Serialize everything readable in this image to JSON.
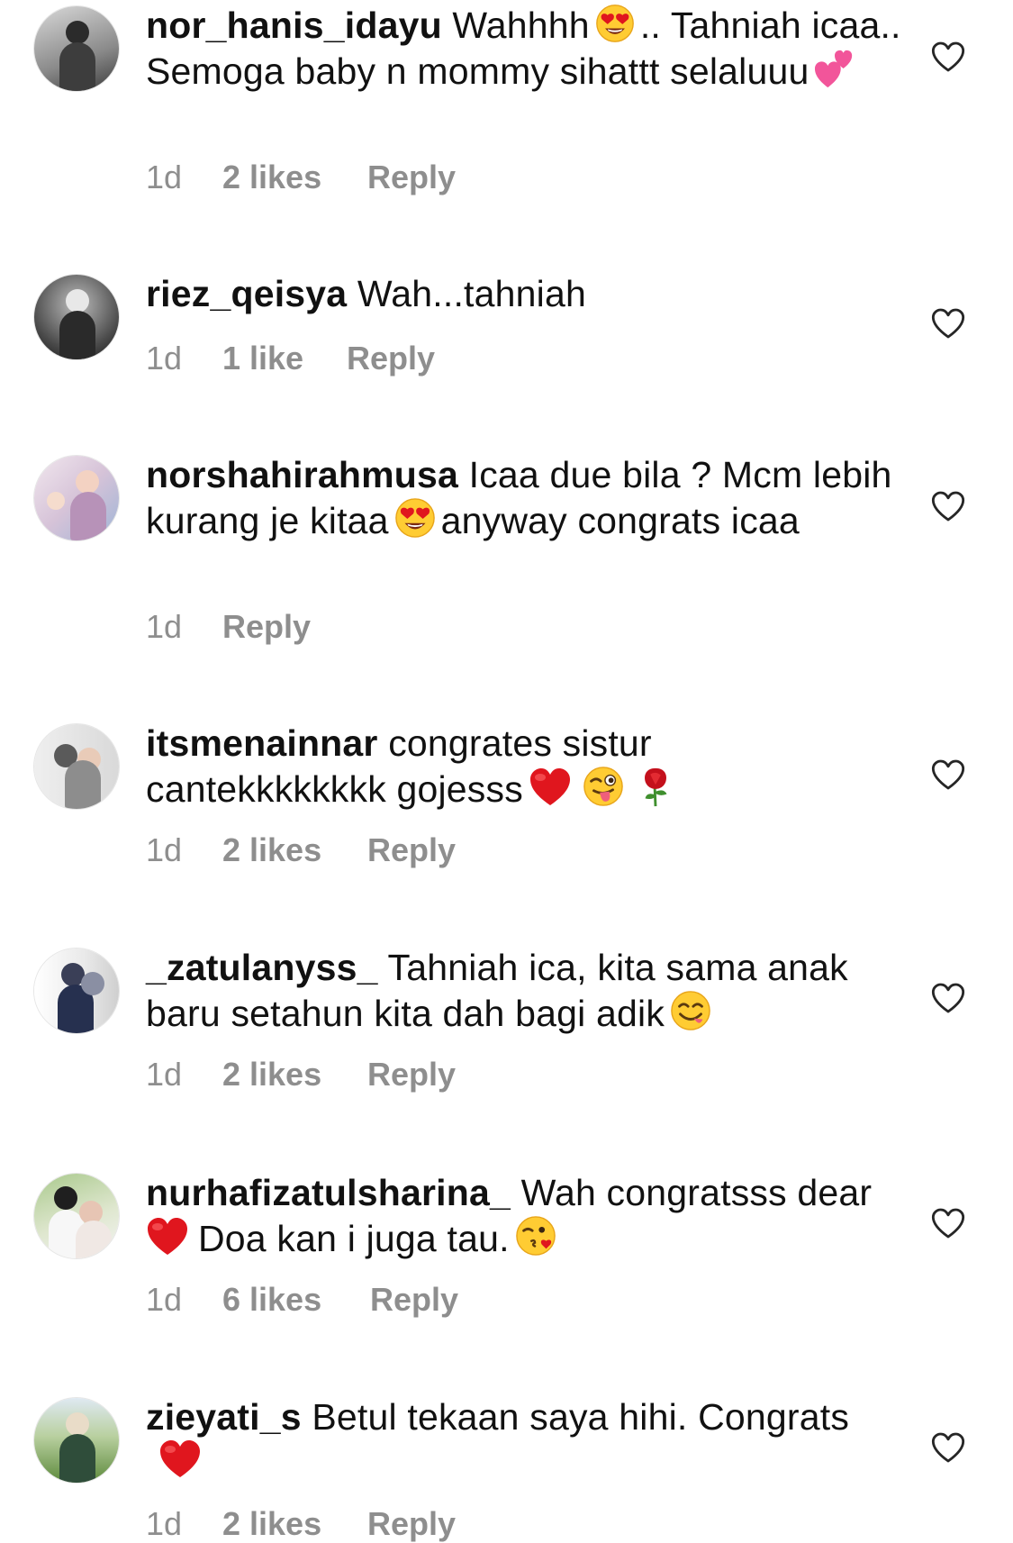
{
  "colors": {
    "text": "#111111",
    "meta": "#8e8e8e",
    "heart_outline": "#262626",
    "emoji_heart": "#e0161e"
  },
  "comments": [
    {
      "username": "nor_hanis_idayu",
      "text_1": "Wahhhh",
      "emoji_1": "heart-eyes-emoji",
      "text_2": ".. Tahniah icaa.. Semoga baby n mommy sihattt selaluuu",
      "emoji_2": "two-hearts-emoji",
      "time": "1d",
      "likes": "2 likes",
      "reply": "Reply"
    },
    {
      "username": "riez_qeisya",
      "text_1": "Wah...tahniah",
      "time": "1d",
      "likes": "1 like",
      "reply": "Reply"
    },
    {
      "username": "norshahirahmusa",
      "text_1": "Icaa due bila ? Mcm lebih kurang je kitaa",
      "emoji_1": "heart-eyes-emoji",
      "text_2": "anyway congrats icaa",
      "time": "1d",
      "reply": "Reply"
    },
    {
      "username": "itsmenainnar",
      "text_1": "congrates sistur cantekkkkkkkk gojesss",
      "emoji_1": "red-heart-emoji",
      "emoji_2": "winking-tongue-emoji",
      "emoji_3": "rose-emoji",
      "time": "1d",
      "likes": "2 likes",
      "reply": "Reply"
    },
    {
      "username": "_zatulanyss_",
      "text_1": "Tahniah ica, kita sama anak baru setahun kita dah bagi adik",
      "emoji_1": "yum-face-emoji",
      "time": "1d",
      "likes": "2 likes",
      "reply": "Reply"
    },
    {
      "username": "nurhafizatulsharina_",
      "text_1": "Wah congratsss dear",
      "emoji_1": "red-heart-emoji",
      "text_2": "Doa kan i juga tau.",
      "emoji_2": "kiss-wink-emoji",
      "time": "1d",
      "likes": "6 likes",
      "reply": "Reply"
    },
    {
      "username": "zieyati_s",
      "text_1": "Betul tekaan saya hihi. Congrats",
      "emoji_1": "red-heart-emoji",
      "time": "1d",
      "likes": "2 likes",
      "reply": "Reply"
    }
  ]
}
